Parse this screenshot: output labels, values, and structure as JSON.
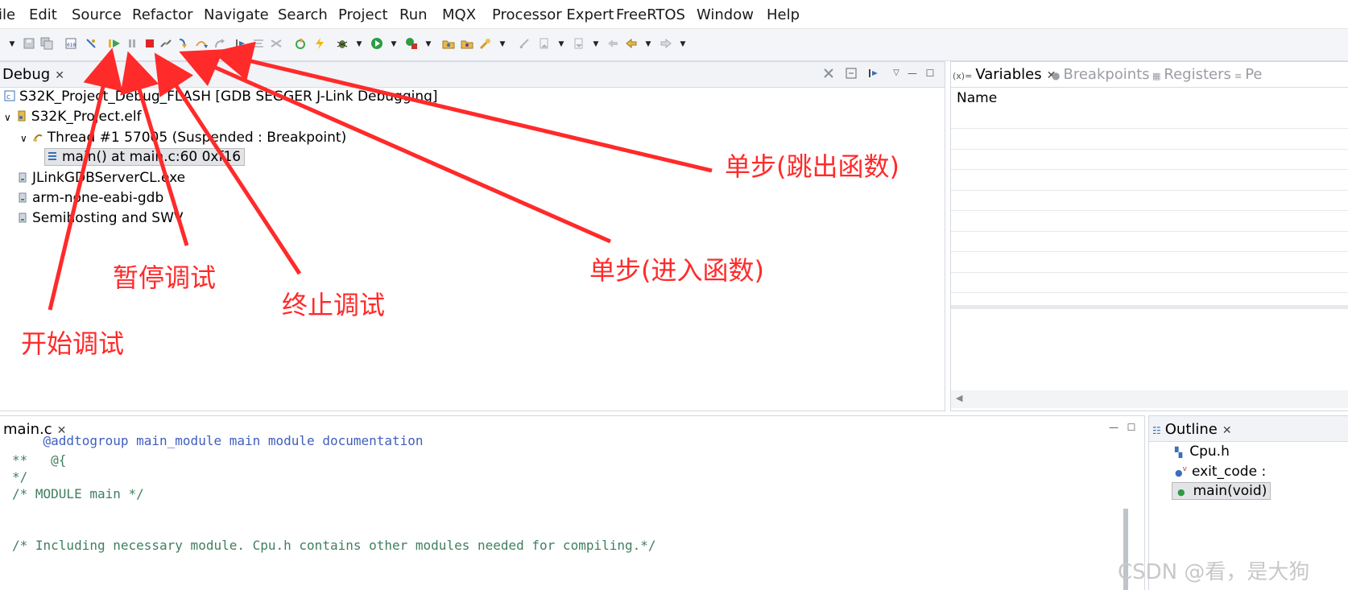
{
  "menu": [
    "ile",
    "Edit",
    "Source",
    "Refactor",
    "Navigate",
    "Search",
    "Project",
    "Run",
    "MQX",
    "Processor Expert",
    "FreeRTOS",
    "Window",
    "Help"
  ],
  "toolbar_icons": [
    "view-menu",
    "save",
    "save-all",
    "memory",
    "connect",
    "resume",
    "suspend",
    "terminate",
    "disconnect",
    "step-into",
    "step-over",
    "step-return",
    "drop-to-frame",
    "instruction-stepping",
    "restart",
    "flash",
    "debug",
    "run",
    "external-tools",
    "open-type",
    "open-task",
    "search",
    "annotation-prev",
    "annotation-next",
    "back",
    "forward"
  ],
  "debug_view": {
    "tab_label": "Debug",
    "launch": "S32K_Project_Debug_FLASH [GDB SEGGER J-Link Debugging]",
    "elf": "S32K_Project.elf",
    "thread": "Thread #1 57005 (Suspended : Breakpoint)",
    "frame": "main() at main.c:60 0xf16",
    "processes": [
      "JLinkGDBServerCL.exe",
      "arm-none-eabi-gdb",
      "Semihosting and SWV"
    ]
  },
  "variables_view": {
    "tabs": [
      "Variables",
      "Breakpoints",
      "Registers",
      "Pe"
    ],
    "column_header": "Name"
  },
  "editor": {
    "tab_label": "main.c",
    "lines": [
      "    @addtogroup main_module main module documentation",
      "**   @{",
      "*/",
      "/* MODULE main */",
      "",
      "",
      "/* Including necessary module. Cpu.h contains other modules needed for compiling.*/"
    ]
  },
  "outline_view": {
    "tab_label": "Outline",
    "items": [
      "Cpu.h",
      "exit_code :",
      "main(void)"
    ]
  },
  "annotations": {
    "start": "开始调试",
    "pause": "暂停调试",
    "terminate": "终止调试",
    "step_into": "单步(进入函数)",
    "step_return": "单步(跳出函数)"
  },
  "watermark": "CSDN @看，是大狗",
  "colors": {
    "annotation": "#ff2a2a",
    "selection": "#e3e4e8",
    "comment": "#3f7f5f",
    "toolbar_bg": "#f4f5f8"
  }
}
